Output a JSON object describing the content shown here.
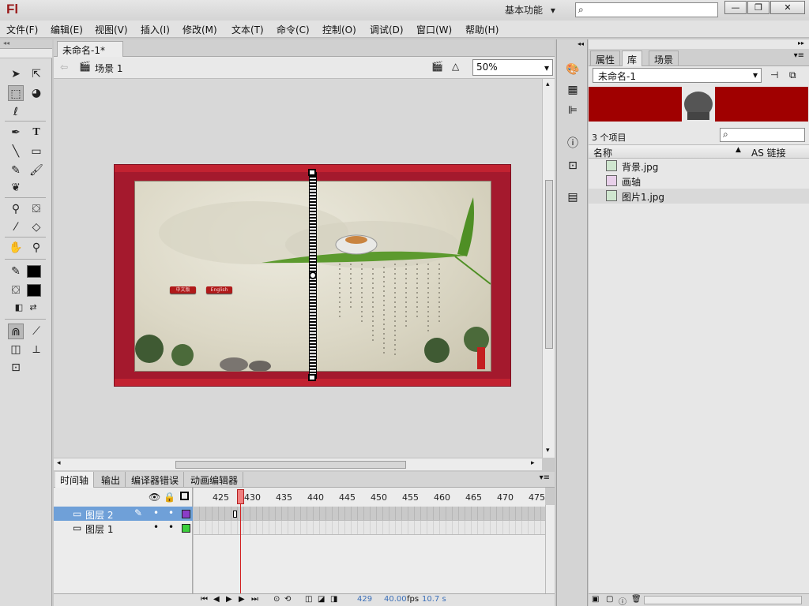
{
  "app": {
    "logo": "Fl",
    "workspace": "基本功能",
    "workspace_arrow": "▾",
    "window_buttons": {
      "minimize": "—",
      "restore": "❐",
      "close": "✕"
    }
  },
  "menu": [
    "文件(F)",
    "编辑(E)",
    "视图(V)",
    "插入(I)",
    "修改(M)",
    "文本(T)",
    "命令(C)",
    "控制(O)",
    "调试(D)",
    "窗口(W)",
    "帮助(H)"
  ],
  "document": {
    "tab_title": "未命名-1*",
    "tab_close": "×",
    "scene": "场景 1",
    "zoom": "50%"
  },
  "timeline": {
    "tabs": [
      "时间轴",
      "输出",
      "编译器错误",
      "动画编辑器"
    ],
    "ruler": [
      "425",
      "430",
      "435",
      "440",
      "445",
      "450",
      "455",
      "460",
      "465",
      "470",
      "475"
    ],
    "layers": [
      {
        "name": "图层 2",
        "color": "#8b3cc8",
        "selected": true
      },
      {
        "name": "图层 1",
        "color": "#3ccf3c",
        "selected": false
      }
    ],
    "status": {
      "frame": "429",
      "fps": "40.00",
      "fps_unit": "fps",
      "time": "10.7 s"
    }
  },
  "library": {
    "tabs": [
      "属性",
      "库",
      "场景"
    ],
    "active_tab": "库",
    "doc": "未命名-1",
    "count": "3 个项目",
    "columns": {
      "name": "名称",
      "linkage": "AS 链接"
    },
    "items": [
      {
        "name": "背景.jpg",
        "icon": "bitmap-icon"
      },
      {
        "name": "画轴",
        "icon": "movieclip-icon"
      },
      {
        "name": "图片1.jpg",
        "icon": "bitmap-icon"
      }
    ]
  },
  "stage": {
    "buttons": [
      "中文版",
      "English"
    ]
  },
  "colors": {
    "frame": "#a4192d",
    "library_preview": "#a00000",
    "selection": "#6fa0d8",
    "playhead": "#d12020"
  }
}
